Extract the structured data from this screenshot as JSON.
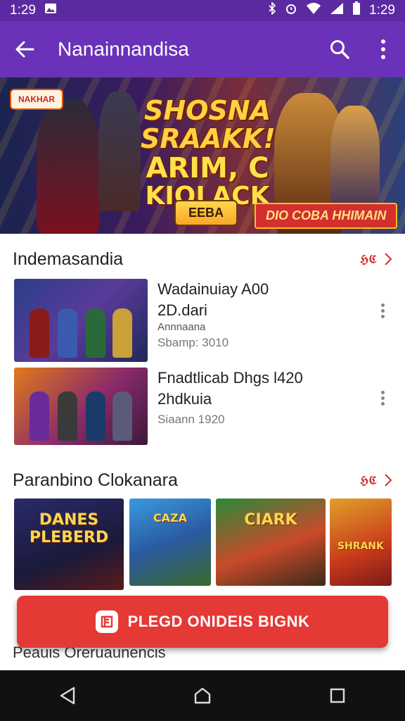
{
  "status_bar": {
    "time_left": "1:29",
    "time_right": "1:29",
    "icons": [
      "image-notification-icon",
      "bluetooth-icon",
      "alarm-icon",
      "wifi-icon",
      "signal-icon",
      "battery-icon"
    ]
  },
  "app_bar": {
    "title": "Nanainnandisa",
    "back_icon": "arrow-back-icon",
    "search_icon": "search-icon",
    "menu_icon": "more-vert-icon",
    "color": "#6a32b8"
  },
  "banner": {
    "logo_text": "NAKHAR",
    "headline_1": "SHOSNA SRAAKK!",
    "headline_2": "ARIM, C",
    "headline_3": "KIOLACK",
    "pill_left": "EEBA",
    "pill_right": "DIO COBA HHIMAIN"
  },
  "section1": {
    "title": "Indemasandia",
    "more_label": "𝕳𝕮",
    "items": [
      {
        "title": "Wadainuiay A00",
        "line2": "2D.dari",
        "sub": "Annnaana",
        "price": "Sbamp: 3010"
      },
      {
        "title": "Fnadtlicab Dhgs l420",
        "line2": "2hdkuia",
        "sub": "",
        "price": "Siaann 1920"
      }
    ]
  },
  "section2": {
    "title": "Paranbino Clokanara",
    "more_label": "𝕳𝕮",
    "cards": [
      {
        "caption": "DANES PLEBERD"
      },
      {
        "caption": "CAZA"
      },
      {
        "caption": "CIARK"
      },
      {
        "caption": "SHRANK"
      }
    ]
  },
  "cta": {
    "label": "PLEGD ONIDEIS BIGNK",
    "icon": "store-icon",
    "color": "#e53935"
  },
  "section3": {
    "title": "Peauis Oreruaunencis"
  },
  "nav": {
    "back": "nav-back-icon",
    "home": "nav-home-icon",
    "recents": "nav-recents-icon"
  }
}
